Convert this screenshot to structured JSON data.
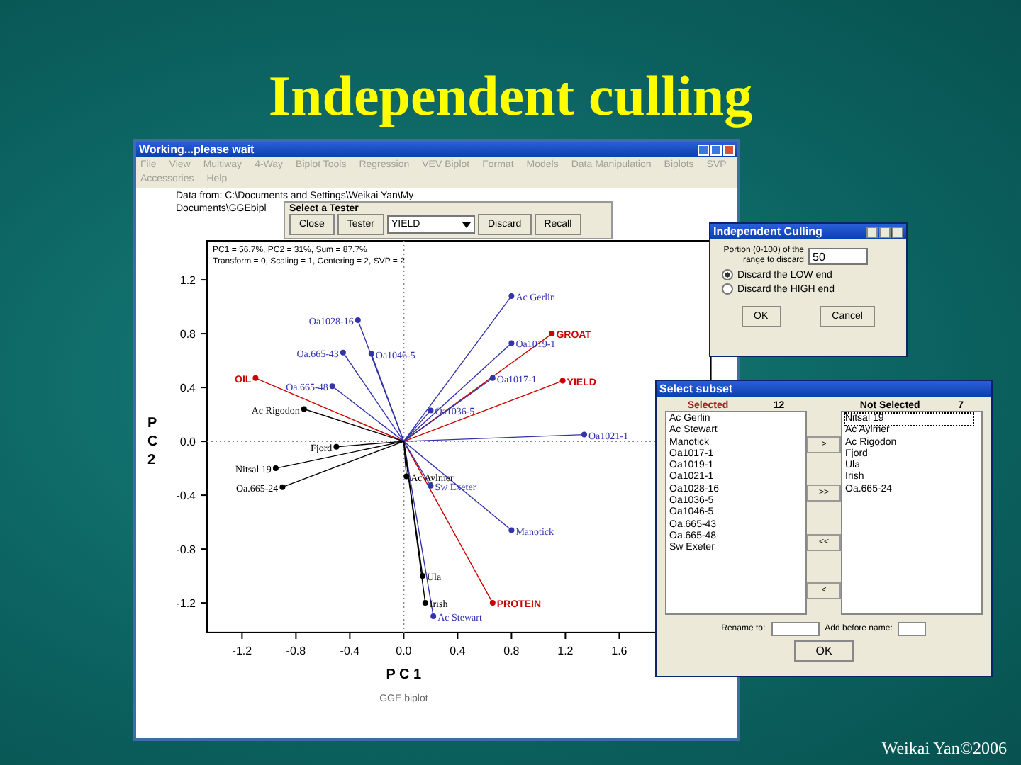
{
  "slide": {
    "title": "Independent culling",
    "footer": "Weikai Yan©2006"
  },
  "main_window": {
    "title": "Working...please wait",
    "menu": [
      "File",
      "View",
      "Multiway",
      "4-Way",
      "Biplot Tools",
      "Regression",
      "VEV Biplot",
      "Format",
      "Models",
      "Data Manipulation",
      "Biplots",
      "SVP",
      "Accessories",
      "Help"
    ],
    "data_lines": [
      "Data from: C:\\Documents and Settings\\Weikai Yan\\My",
      "Documents\\GGEbipl"
    ],
    "tester_panel": {
      "title": "Select a Tester",
      "buttons": [
        "Close",
        "Tester"
      ],
      "dropdown": {
        "value": "YIELD"
      },
      "buttons_after": [
        "Discard",
        "Recall"
      ]
    },
    "biplot": {
      "info": [
        "PC1 = 56.7%, PC2 = 31%, Sum = 87.7%",
        "Transform = 0, Scaling = 1, Centering = 2, SVP = 2"
      ],
      "caption": "GGE biplot",
      "chart_data": {
        "type": "scatter",
        "xlabel": "P C 1",
        "ylabel": "P C 2",
        "x": [
          -1.1,
          1.1,
          1.18,
          0.66,
          0.8,
          0.8,
          0.66,
          0.2,
          1.34,
          -0.34,
          -0.45,
          -0.24,
          -0.53,
          0.2,
          0.8,
          0.22,
          -0.74,
          -0.5,
          -0.95,
          -0.9,
          0.02,
          0.14,
          0.16
        ],
        "xlim": [
          -1.46,
          2.28
        ],
        "ylim": [
          -1.42,
          1.49
        ],
        "series": [
          {
            "color": "#cc0000",
            "values": [
              0.47,
              0.8,
              0.45,
              -1.2,
              null,
              null,
              null,
              null,
              null,
              null,
              null,
              null,
              null,
              null,
              null,
              null,
              null,
              null,
              null,
              null,
              null,
              null,
              null
            ]
          },
          {
            "color": "#3333aa",
            "values": [
              null,
              null,
              null,
              null,
              1.08,
              0.73,
              0.47,
              0.23,
              0.05,
              0.9,
              0.66,
              0.65,
              0.41,
              -0.33,
              -0.66,
              -1.3,
              null,
              null,
              null,
              null,
              null,
              null,
              null
            ]
          },
          {
            "color": "#000000",
            "values": [
              null,
              null,
              null,
              null,
              null,
              null,
              null,
              null,
              null,
              null,
              null,
              null,
              null,
              null,
              null,
              null,
              0.24,
              -0.04,
              -0.2,
              -0.34,
              -0.26,
              -1.0,
              -1.2
            ]
          }
        ],
        "xticks": [
          {
            "value": -1.2,
            "label": "-1.2"
          },
          {
            "value": -0.8,
            "label": "-0.8"
          },
          {
            "value": -0.4,
            "label": "-0.4"
          },
          {
            "value": 0,
            "label": "0.0"
          },
          {
            "value": 0.4,
            "label": "0.4"
          },
          {
            "value": 0.8,
            "label": "0.8"
          },
          {
            "value": 1.2,
            "label": "1.2"
          },
          {
            "value": 1.6,
            "label": "1.6"
          }
        ],
        "yticks": [
          {
            "value": 1.2,
            "label": "1.2"
          },
          {
            "value": 0.8,
            "label": "0.8"
          },
          {
            "value": 0.4,
            "label": "0.4"
          },
          {
            "value": 0,
            "label": "0.0"
          },
          {
            "value": -0.4,
            "label": "-0.4"
          },
          {
            "value": -0.8,
            "label": "-0.8"
          },
          {
            "value": -1.2,
            "label": "-1.2"
          }
        ],
        "annotations": [
          {
            "text": "OIL"
          },
          {
            "text": "GROAT"
          },
          {
            "text": "YIELD"
          },
          {
            "text": "PROTEIN"
          },
          {
            "text": "Ac Gerlin"
          },
          {
            "text": "Oa1019-1"
          },
          {
            "text": "Oa1017-1"
          },
          {
            "text": "Oa1036-5"
          },
          {
            "text": "Oa1021-1"
          },
          {
            "text": "Oa1028-16"
          },
          {
            "text": "Oa.665-43"
          },
          {
            "text": "Oa1046-5"
          },
          {
            "text": "Oa.665-48"
          },
          {
            "text": "Sw Exeter"
          },
          {
            "text": "Manotick"
          },
          {
            "text": "Ac Stewart"
          },
          {
            "text": "Ac Rigodon"
          },
          {
            "text": "Fjord"
          },
          {
            "text": "Nitsal 19"
          },
          {
            "text": "Oa.665-24"
          },
          {
            "text": "Ac Aylmer"
          },
          {
            "text": "Ula"
          },
          {
            "text": "Irish"
          }
        ]
      }
    }
  },
  "culling_dialog": {
    "title": "Independent Culling",
    "prompt": "Portion (0-100) of the range to discard",
    "value": "50",
    "options": [
      {
        "label": "Discard the LOW end",
        "selected": true
      },
      {
        "label": "Discard the HIGH end",
        "selected": false
      }
    ],
    "buttons": [
      "OK",
      "Cancel"
    ]
  },
  "subset_dialog": {
    "title": "Select subset",
    "selected_header": "Selected",
    "selected_count": "12",
    "not_selected_header": "Not Selected",
    "not_selected_count": "7",
    "selected_items": [
      {
        "label": "Ac Gerlin",
        "focused": false
      },
      {
        "label": "Ac Stewart",
        "focused": false
      },
      {
        "label": "Manotick",
        "focused": false
      },
      {
        "label": "Oa1017-1",
        "focused": false
      },
      {
        "label": "Oa1019-1",
        "focused": false
      },
      {
        "label": "Oa1021-1",
        "focused": false
      },
      {
        "label": "Oa1028-16",
        "focused": false
      },
      {
        "label": "Oa1036-5",
        "focused": false
      },
      {
        "label": "Oa1046-5",
        "focused": false
      },
      {
        "label": "Oa.665-43",
        "focused": false
      },
      {
        "label": "Oa.665-48",
        "focused": false
      },
      {
        "label": "Sw Exeter",
        "focused": false
      }
    ],
    "not_selected_items": [
      {
        "label": "Nitsal 19",
        "focused": true
      },
      {
        "label": "Ac Aylmer",
        "focused": false
      },
      {
        "label": "Ac Rigodon",
        "focused": false
      },
      {
        "label": "Fjord",
        "focused": false
      },
      {
        "label": "Ula",
        "focused": false
      },
      {
        "label": "Irish",
        "focused": false
      },
      {
        "label": "Oa.665-24",
        "focused": false
      }
    ],
    "move_buttons": [
      ">",
      ">>",
      "<<",
      "<"
    ],
    "rename_label": "Rename to:",
    "add_label": "Add before name:",
    "ok": "OK"
  }
}
